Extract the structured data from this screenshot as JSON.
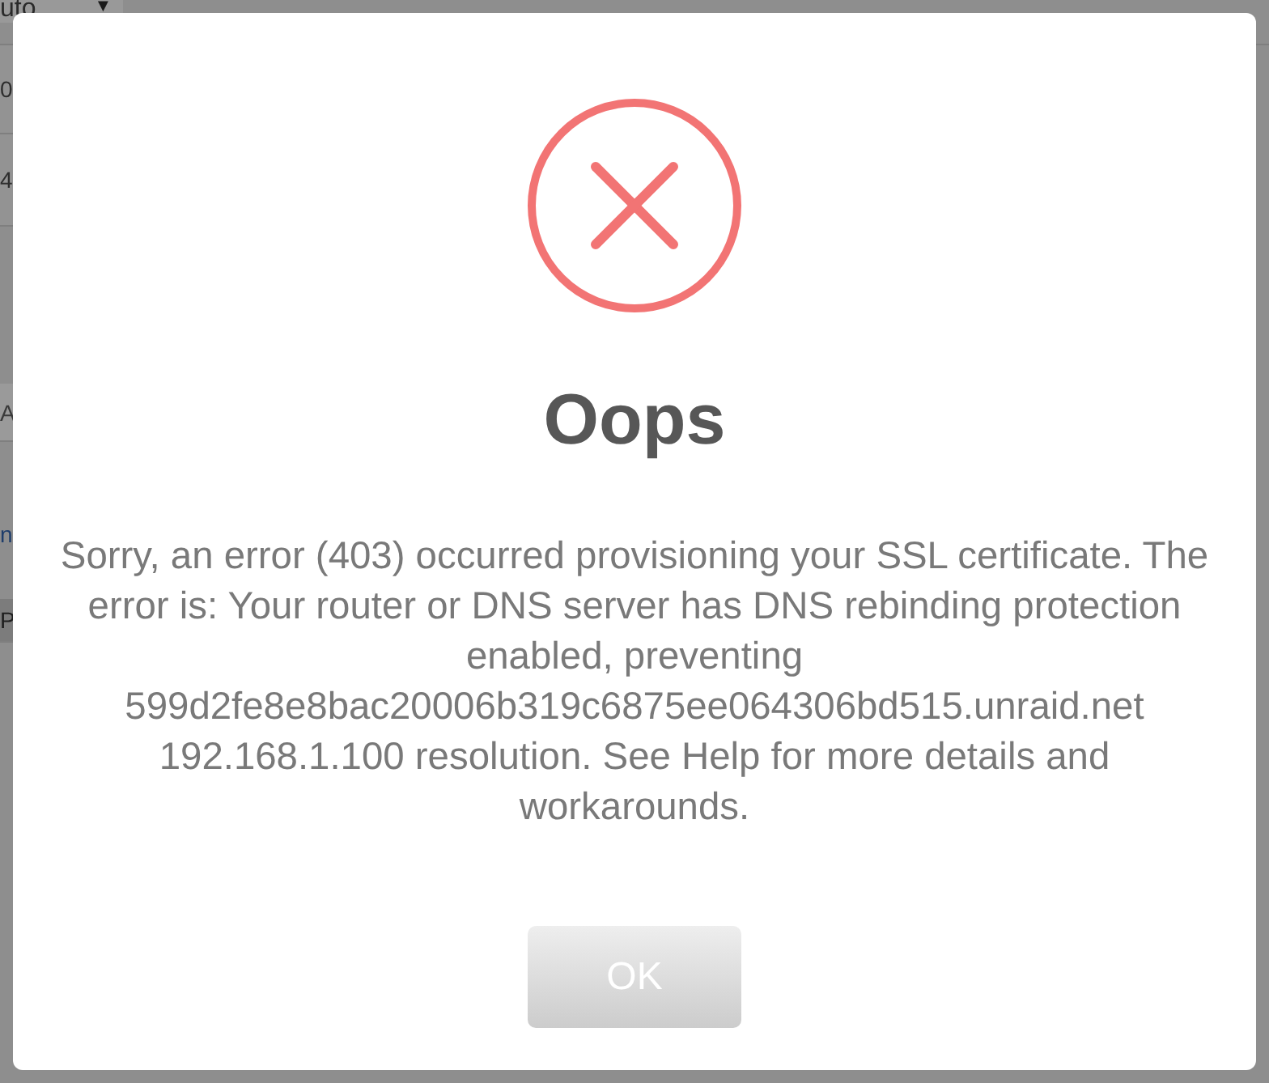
{
  "background_page": {
    "dropdown": {
      "value": "uto",
      "caret": "▼"
    },
    "rows": [
      {
        "kind": "plain",
        "text": "0"
      },
      {
        "kind": "plain",
        "text": "4"
      },
      {
        "kind": "band",
        "text": "A"
      },
      {
        "kind": "link",
        "text": "n"
      },
      {
        "kind": "dark-band",
        "text": "P"
      }
    ]
  },
  "dialog": {
    "title": "Oops",
    "message": "Sorry, an error (403) occurred provisioning your SSL certificate. The error is: Your router or DNS server has DNS rebinding protection enabled, preventing 599d2fe8e8bac20006b319c6875ee064306bd515.unraid.net 192.168.1.100 resolution. See Help for more details and workarounds.",
    "buttons": [
      {
        "label": "OK",
        "kind": "confirm"
      }
    ]
  }
}
